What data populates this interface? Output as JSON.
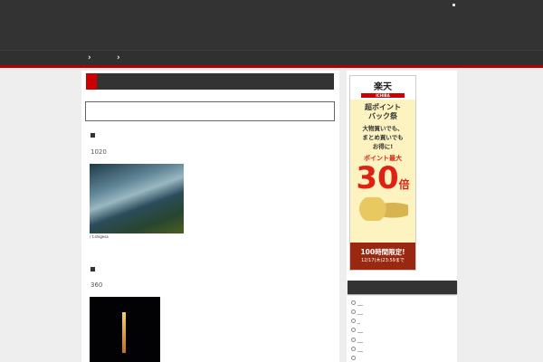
{
  "nav": {
    "items": [
      "›",
      "›"
    ]
  },
  "posts": [
    {
      "count": "1020",
      "caption": "/ t.shigesa"
    },
    {
      "count": "360"
    }
  ],
  "ad": {
    "logo": "楽天",
    "logo_sub": "ICHIBA",
    "line1": "超ポイント",
    "line2": "バック祭",
    "line3": "大物買いでも、",
    "line4": "まとめ買いでも",
    "line5": "お得に!",
    "line6": "ポイント最大",
    "big": "30",
    "bai": "倍",
    "foot1": "100時間限定!",
    "foot2": "12/17(木)23:59まで"
  },
  "sidebar": {
    "list": [
      "__",
      "__",
      "_",
      "__",
      "__",
      "__",
      ""
    ]
  }
}
